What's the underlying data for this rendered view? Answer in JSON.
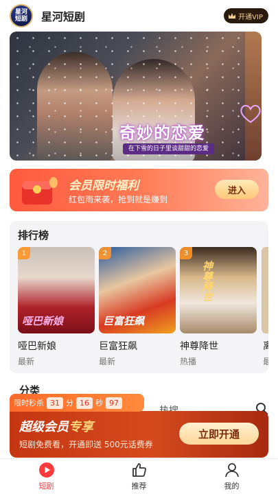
{
  "header": {
    "logo_text": "星河\n短剧",
    "app_title": "星河短剧",
    "vip_button": "开通VIP"
  },
  "banner": {
    "title": "奇妙的恋爱",
    "subtitle": "在下雪的日子里谈甜甜的恋爱"
  },
  "promo": {
    "title": "会员限时福利",
    "subtitle": "红包雨来袭，抢到就是赚到",
    "button": "进入"
  },
  "ranking": {
    "heading": "排行榜",
    "items": [
      {
        "rank": "1",
        "name": "哑巴新娘",
        "tag": "最新",
        "poster_text": "哑巴新娘"
      },
      {
        "rank": "2",
        "name": "巨富狂飙",
        "tag": "最新",
        "poster_text": "巨富狂飙"
      },
      {
        "rank": "3",
        "name": "神尊降世",
        "tag": "热播",
        "poster_text": "神尊降世"
      }
    ],
    "partial_next_name": "离",
    "partial_next_tag": "最"
  },
  "category": {
    "heading": "分类",
    "hot_search": "热搜"
  },
  "countdown": {
    "label": "限时秒杀",
    "hours": "31",
    "hours_unit": "分",
    "minutes": "16",
    "minutes_unit": "秒",
    "ms": "97"
  },
  "vip_banner": {
    "title_main": "超级会员",
    "title_accent": "专享",
    "subtitle": "短剧免费看，开通即送 500元话费券",
    "button": "立即开通"
  },
  "nav": {
    "items": [
      {
        "label": "短剧",
        "icon": "play-icon",
        "active": true
      },
      {
        "label": "推荐",
        "icon": "thumbs-up-icon",
        "active": false
      },
      {
        "label": "我的",
        "icon": "user-icon",
        "active": false
      }
    ]
  },
  "colors": {
    "accent": "#ff3a3a",
    "vip_gold": "#f4d08e",
    "promo_orange": "#ff5a3e"
  }
}
